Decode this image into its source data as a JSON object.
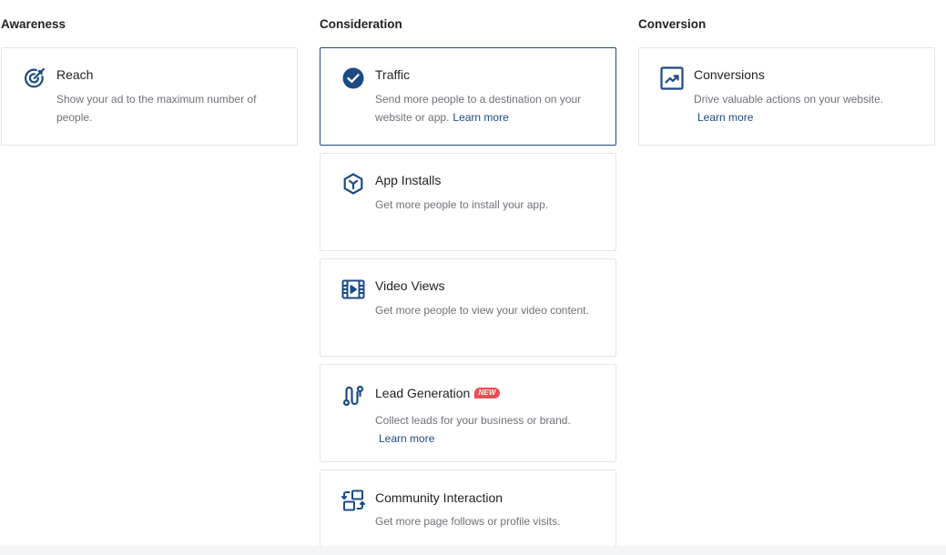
{
  "columns": {
    "awareness": {
      "heading": "Awareness",
      "cards": [
        {
          "title": "Reach",
          "description": "Show your ad to the maximum number of people.",
          "icon": "target-icon"
        }
      ]
    },
    "consideration": {
      "heading": "Consideration",
      "cards": [
        {
          "title": "Traffic",
          "description": "Send more people to a destination on your website or app.",
          "learn_more": "Learn more",
          "icon": "check-circle-icon",
          "selected": true
        },
        {
          "title": "App Installs",
          "description": "Get more people to install your app.",
          "icon": "app-hexagon-icon"
        },
        {
          "title": "Video Views",
          "description": "Get more people to view your video content.",
          "icon": "film-play-icon"
        },
        {
          "title": "Lead Generation",
          "badge": "NEW",
          "description": "Collect leads for your business or brand.",
          "learn_more": "Learn more",
          "icon": "lead-path-icon"
        },
        {
          "title": "Community Interaction",
          "description": "Get more page follows or profile visits.",
          "icon": "community-swap-icon"
        }
      ]
    },
    "conversion": {
      "heading": "Conversion",
      "cards": [
        {
          "title": "Conversions",
          "description": "Drive valuable actions on your website.",
          "learn_more": "Learn more",
          "icon": "trend-chart-icon"
        }
      ]
    }
  },
  "colors": {
    "accent": "#1b4b84",
    "badge": "#ef4b56",
    "border": "#e3e5e8",
    "muted_text": "#6f7178"
  }
}
